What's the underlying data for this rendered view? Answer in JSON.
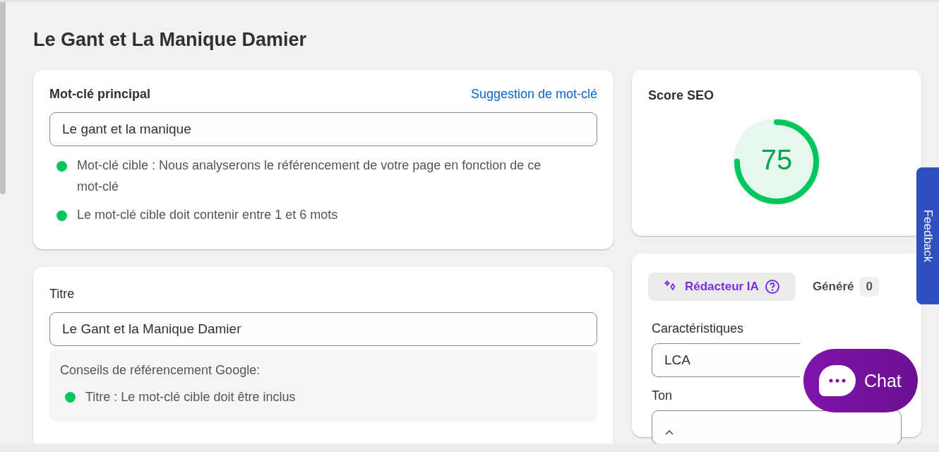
{
  "page_title": "Le Gant et La Manique Damier",
  "keyword_card": {
    "label": "Mot-clé principal",
    "link": "Suggestion de mot-clé",
    "value": "Le gant et la manique",
    "hints": [
      {
        "text": "Mot-clé cible : Nous analyserons le référencement de votre page en fonction de ce mot-clé",
        "met": true
      },
      {
        "text": "Le mot-clé cible doit contenir entre 1 et 6 mots",
        "met": true
      }
    ]
  },
  "title_card": {
    "label": "Titre",
    "value": "Le Gant et la Manique Damier",
    "tips_heading": "Conseils de référencement Google:",
    "tips": [
      {
        "text": "Titre : Le mot-clé cible doit être inclus",
        "met": true
      }
    ]
  },
  "score_card": {
    "label": "Score SEO",
    "score": "75",
    "level": 0.75
  },
  "ai_card": {
    "tabs": [
      {
        "label": "Rédacteur IA",
        "selected": true
      },
      {
        "label": "Généré",
        "count": "0",
        "selected": false
      }
    ],
    "fields": [
      {
        "label": "Caractéristiques",
        "value": "LCA"
      },
      {
        "label": "Ton"
      }
    ]
  },
  "chat_button": {
    "label": "Chat"
  },
  "feedback_tab": {
    "label": "Feedback"
  }
}
